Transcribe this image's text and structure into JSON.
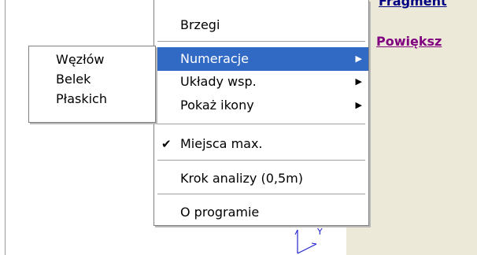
{
  "right_panel": {
    "fragment_link": "Fragment",
    "powieksz_link": "Powiększ"
  },
  "main_menu": {
    "items": [
      {
        "label": "Brzegi"
      },
      {
        "label": "Numeracje",
        "submenu": true,
        "highlighted": true
      },
      {
        "label": "Układy wsp.",
        "submenu": true
      },
      {
        "label": "Pokaż ikony",
        "submenu": true
      },
      {
        "label": "Miejsca max.",
        "checked": true
      },
      {
        "label": "Krok analizy (0,5m)"
      },
      {
        "label": "O programie"
      }
    ],
    "arrow_glyph": "▶",
    "check_glyph": "✔"
  },
  "sub_menu": {
    "items": [
      {
        "label": "Węzłów"
      },
      {
        "label": "Belek"
      },
      {
        "label": "Płaskich"
      }
    ]
  },
  "axis": {
    "y_label": "Y"
  },
  "colors": {
    "highlight": "#316ac5",
    "panel": "#ece9d8",
    "link": "#000080",
    "visited_link": "#800080",
    "axis": "#2020d0"
  }
}
